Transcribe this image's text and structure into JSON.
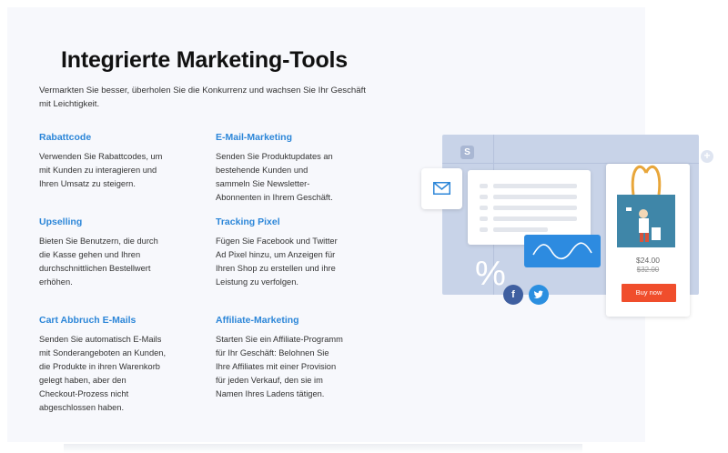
{
  "heading": {
    "title": "Integrierte Marketing-Tools",
    "subtitle": "Vermarkten Sie besser, überholen Sie die Konkurrenz und wachsen Sie Ihr Geschäft mit Leichtigkeit."
  },
  "features": [
    {
      "title": "Rabattcode",
      "text": "Verwenden Sie Rabattcodes, um mit Kunden zu interagieren und Ihren Umsatz zu steigern."
    },
    {
      "title": "E-Mail-Marketing",
      "text": "Senden Sie Produktupdates an bestehende Kunden und sammeln Sie Newsletter-Abonnenten in Ihrem Geschäft."
    },
    {
      "title": "Upselling",
      "text": "Bieten Sie Benutzern, die durch die Kasse gehen und Ihren durchschnittlichen Bestellwert erhöhen."
    },
    {
      "title": "Tracking Pixel",
      "text": "Fügen Sie Facebook und Twitter Ad Pixel hinzu, um Anzeigen für Ihren Shop zu erstellen und ihre Leistung zu verfolgen."
    },
    {
      "title": "Cart Abbruch E-Mails",
      "text": "Senden Sie automatisch E-Mails mit Sonderangeboten an Kunden, die Produkte in ihren Warenkorb gelegt haben, aber den Checkout-Prozess nicht abgeschlossen haben."
    },
    {
      "title": "Affiliate-Marketing",
      "text": "Starten Sie ein Affiliate-Programm für Ihr Geschäft: Belohnen Sie Ihre Affiliates mit einer Provision für jeden Verkauf, den sie im Namen Ihres Ladens tätigen."
    }
  ],
  "illustration": {
    "logo_letter": "S",
    "percent_symbol": "%",
    "facebook_letter": "f",
    "plus_symbol": "+",
    "price": "$24.00",
    "old_price": "$32.00",
    "buy_label": "Buy now",
    "icons": [
      "mail-icon",
      "facebook-icon",
      "twitter-icon",
      "plus-icon",
      "tote-bag-image"
    ],
    "colors": {
      "accent_blue": "#2c86d8",
      "buy_button": "#f04e2c",
      "board": "#c8d3e8",
      "bag": "#3f86a8"
    }
  }
}
